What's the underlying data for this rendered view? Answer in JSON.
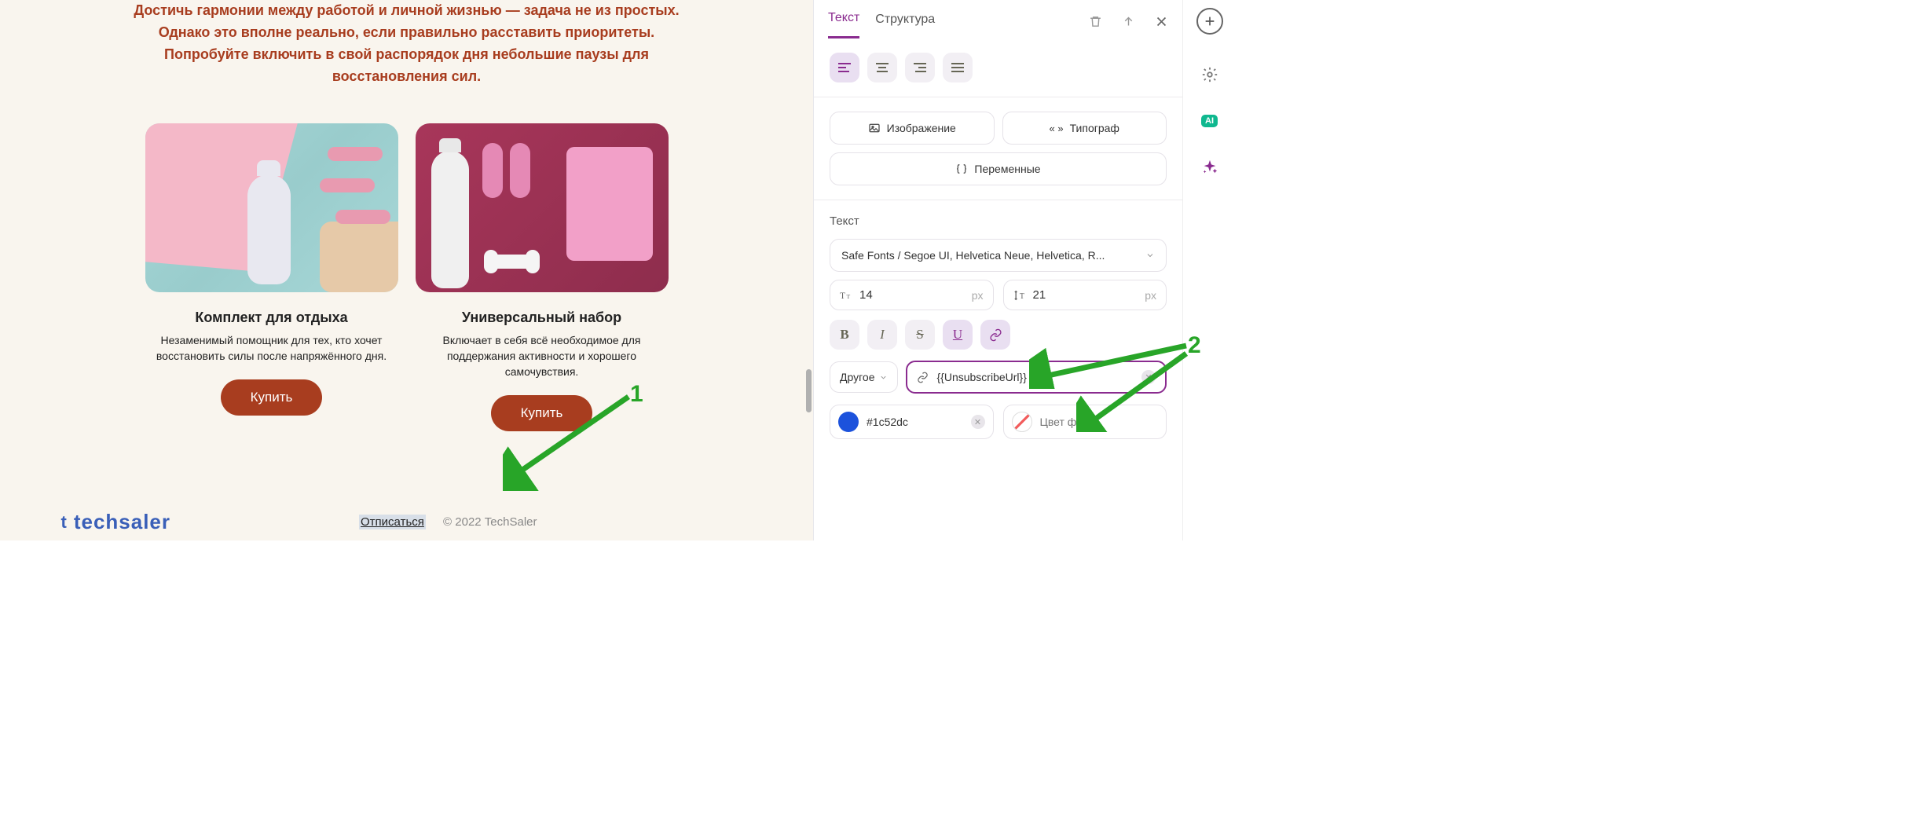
{
  "intro_text": "Достичь гармонии между работой и личной жизнью — задача не из простых. Однако это вполне реально, если правильно расставить приоритеты. Попробуйте включить в свой распорядок дня небольшие паузы для восстановления сил.",
  "products": [
    {
      "title": "Комплект для отдыха",
      "desc": "Незаменимый помощник для тех, кто хочет восстановить силы после напряжённого дня.",
      "btn": "Купить"
    },
    {
      "title": "Универсальный набор",
      "desc": "Включает в себя всё необходимое для поддержания активности и хорошего самочувствия.",
      "btn": "Купить"
    }
  ],
  "footer": {
    "brand": "techsaler",
    "unsubscribe": "Отписаться",
    "copyright": "© 2022 TechSaler"
  },
  "tabs": {
    "text": "Текст",
    "structure": "Структура"
  },
  "buttons": {
    "image": "Изображение",
    "typograf": "Типограф",
    "variables": "Переменные"
  },
  "panel": {
    "text_label": "Текст",
    "font": "Safe Fonts / Segoe UI, Helvetica Neue, Helvetica, R...",
    "font_size": "14",
    "line_height": "21",
    "unit": "px",
    "link_type": "Другое",
    "link_value": "{{UnsubscribeUrl}}",
    "text_color": "#1c52dc",
    "bg_placeholder": "Цвет фона"
  },
  "annotations": {
    "one": "1",
    "two": "2"
  },
  "rail": {
    "ai": "AI"
  }
}
